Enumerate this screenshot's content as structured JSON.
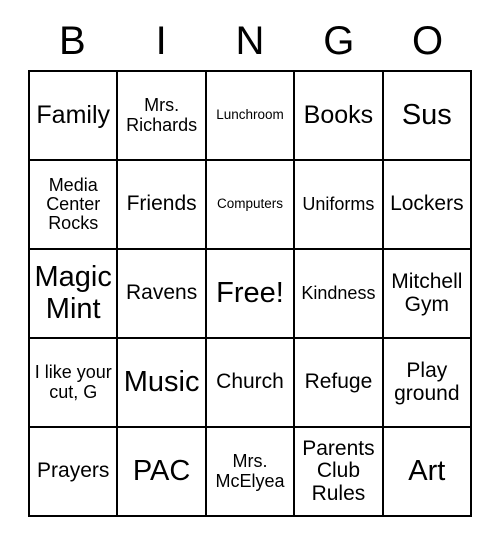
{
  "card": {
    "header_letters": [
      "B",
      "I",
      "N",
      "G",
      "O"
    ],
    "rows": [
      [
        {
          "text": "Family",
          "size": "fs-lg"
        },
        {
          "text": "Mrs. Richards",
          "size": "fs-sm"
        },
        {
          "text": "Lunchroom",
          "size": "fs-xxs"
        },
        {
          "text": "Books",
          "size": "fs-lg"
        },
        {
          "text": "Sus",
          "size": "fs-xl"
        }
      ],
      [
        {
          "text": "Media Center Rocks",
          "size": "fs-sm"
        },
        {
          "text": "Friends",
          "size": "fs-md"
        },
        {
          "text": "Computers",
          "size": "fs-xxs"
        },
        {
          "text": "Uniforms",
          "size": "fs-sm"
        },
        {
          "text": "Lockers",
          "size": "fs-md"
        }
      ],
      [
        {
          "text": "Magic Mint",
          "size": "fs-xl"
        },
        {
          "text": "Ravens",
          "size": "fs-md"
        },
        {
          "text": "Free!",
          "size": "fs-xl"
        },
        {
          "text": "Kindness",
          "size": "fs-sm"
        },
        {
          "text": "Mitchell Gym",
          "size": "fs-md"
        }
      ],
      [
        {
          "text": "I like your cut, G",
          "size": "fs-sm"
        },
        {
          "text": "Music",
          "size": "fs-xl"
        },
        {
          "text": "Church",
          "size": "fs-md"
        },
        {
          "text": "Refuge",
          "size": "fs-md"
        },
        {
          "text": "Play ground",
          "size": "fs-md"
        }
      ],
      [
        {
          "text": "Prayers",
          "size": "fs-md"
        },
        {
          "text": "PAC",
          "size": "fs-xl"
        },
        {
          "text": "Mrs. McElyea",
          "size": "fs-sm"
        },
        {
          "text": "Parents Club Rules",
          "size": "fs-md"
        },
        {
          "text": "Art",
          "size": "fs-xl"
        }
      ]
    ]
  }
}
